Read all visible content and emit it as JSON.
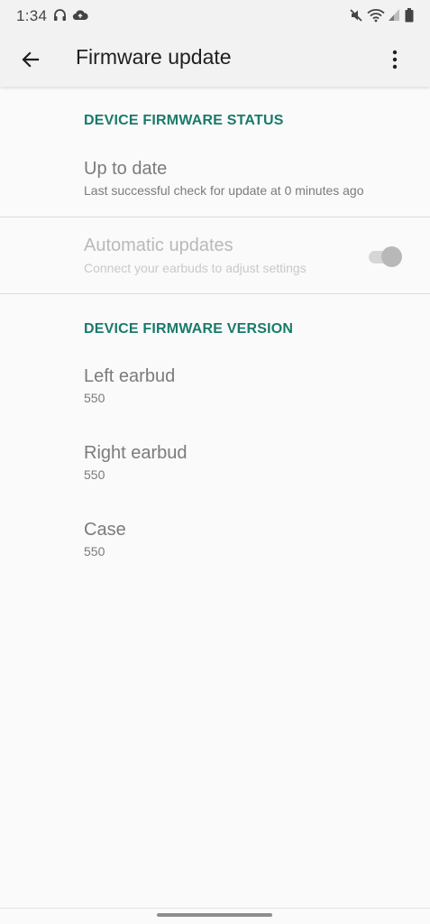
{
  "status_bar": {
    "time": "1:34",
    "icons": [
      "headphones-icon",
      "cloud-upload-icon",
      "mute-icon",
      "wifi-icon",
      "signal-icon",
      "battery-icon"
    ]
  },
  "app_bar": {
    "title": "Firmware update",
    "back_icon": "arrow-back-icon",
    "more_icon": "more-vert-icon"
  },
  "firmware_status": {
    "header": "DEVICE FIRMWARE STATUS",
    "status_title": "Up to date",
    "status_subtitle": "Last successful check for update at 0 minutes ago",
    "auto_updates_title": "Automatic updates",
    "auto_updates_subtitle": "Connect your earbuds to adjust settings",
    "auto_updates_enabled": true,
    "auto_updates_disabled_state": true
  },
  "firmware_version": {
    "header": "DEVICE FIRMWARE VERSION",
    "items": [
      {
        "label": "Left earbud",
        "version": "550"
      },
      {
        "label": "Right earbud",
        "version": "550"
      },
      {
        "label": "Case",
        "version": "550"
      }
    ]
  },
  "colors": {
    "accent": "#1a7a6a",
    "background": "#fafafa",
    "app_bar": "#f2f2f2",
    "secondary_text": "#7b7b7b"
  }
}
